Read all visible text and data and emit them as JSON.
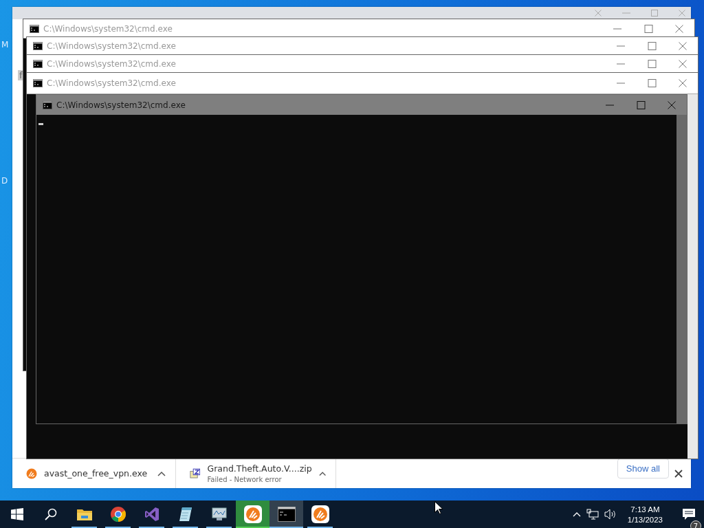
{
  "desktop_fragments": [
    "M",
    "D"
  ],
  "browser": {
    "fragment": "f",
    "downloads": [
      {
        "kind": "exe",
        "name": "avast_one_free_vpn.exe"
      },
      {
        "kind": "zip",
        "name": "Grand.Theft.Auto.V....zip",
        "status": "Failed - Network error"
      }
    ],
    "show_all": "Show all"
  },
  "windows": [
    {
      "title": "C:\\Windows\\system32\\cmd.exe",
      "active": false
    },
    {
      "title": "C:\\Windows\\system32\\cmd.exe",
      "active": false
    },
    {
      "title": "C:\\Windows\\system32\\cmd.exe",
      "active": false
    },
    {
      "title": "C:\\Windows\\system32\\cmd.exe",
      "active": false
    },
    {
      "title": "C:\\Windows\\system32\\cmd.exe",
      "active": true
    }
  ],
  "taskbar": {
    "apps": [
      {
        "kind": "folder",
        "selected": false,
        "flashing": false
      },
      {
        "kind": "chrome",
        "selected": false,
        "flashing": false
      },
      {
        "kind": "vs",
        "selected": false,
        "flashing": false
      },
      {
        "kind": "notepad",
        "selected": false,
        "flashing": false
      },
      {
        "kind": "monitor",
        "selected": false,
        "flashing": false
      },
      {
        "kind": "avast",
        "selected": false,
        "flashing": true
      },
      {
        "kind": "cmd",
        "selected": true,
        "flashing": false
      },
      {
        "kind": "avast",
        "selected": false,
        "flashing": false
      }
    ],
    "time": "7:13 AM",
    "date": "1/13/2023",
    "notifications": "7"
  }
}
